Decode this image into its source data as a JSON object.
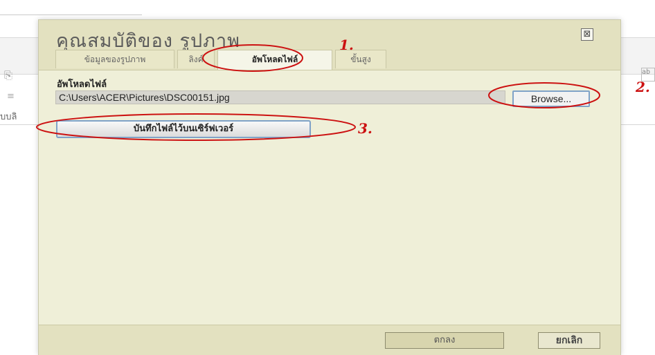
{
  "background": {
    "left_cut_text": "บบลิ",
    "right_cut_text": "ab",
    "icon1": "paste-icon",
    "icon2": "align-icon"
  },
  "dialog": {
    "title": "คุณสมบัติของ รูปภาพ",
    "close_icon": "⊠",
    "tabs": [
      {
        "label": "ข้อมูลของรูปภาพ",
        "active": false
      },
      {
        "label": "ลิงค์",
        "active": false
      },
      {
        "label": "อัพโหลดไฟล์",
        "active": true
      },
      {
        "label": "ขั้นสูง",
        "active": false
      }
    ],
    "upload": {
      "field_label": "อัพโหลดไฟล์",
      "path_value": "C:\\Users\\ACER\\Pictures\\DSC00151.jpg",
      "browse_label": "Browse...",
      "save_label": "บันทึกไฟล์ไว้บนเซิร์ฟเวอร์"
    },
    "footer": {
      "ok_label": "ตกลง",
      "cancel_label": "ยกเลิก"
    }
  },
  "annotations": [
    {
      "label": "1."
    },
    {
      "label": "2."
    },
    {
      "label": "3."
    }
  ],
  "colors": {
    "dialog_bg": "#efefd8",
    "header_bg": "#e3e1c0",
    "annotation": "#cc1111",
    "button_border": "#7fa2c8"
  }
}
